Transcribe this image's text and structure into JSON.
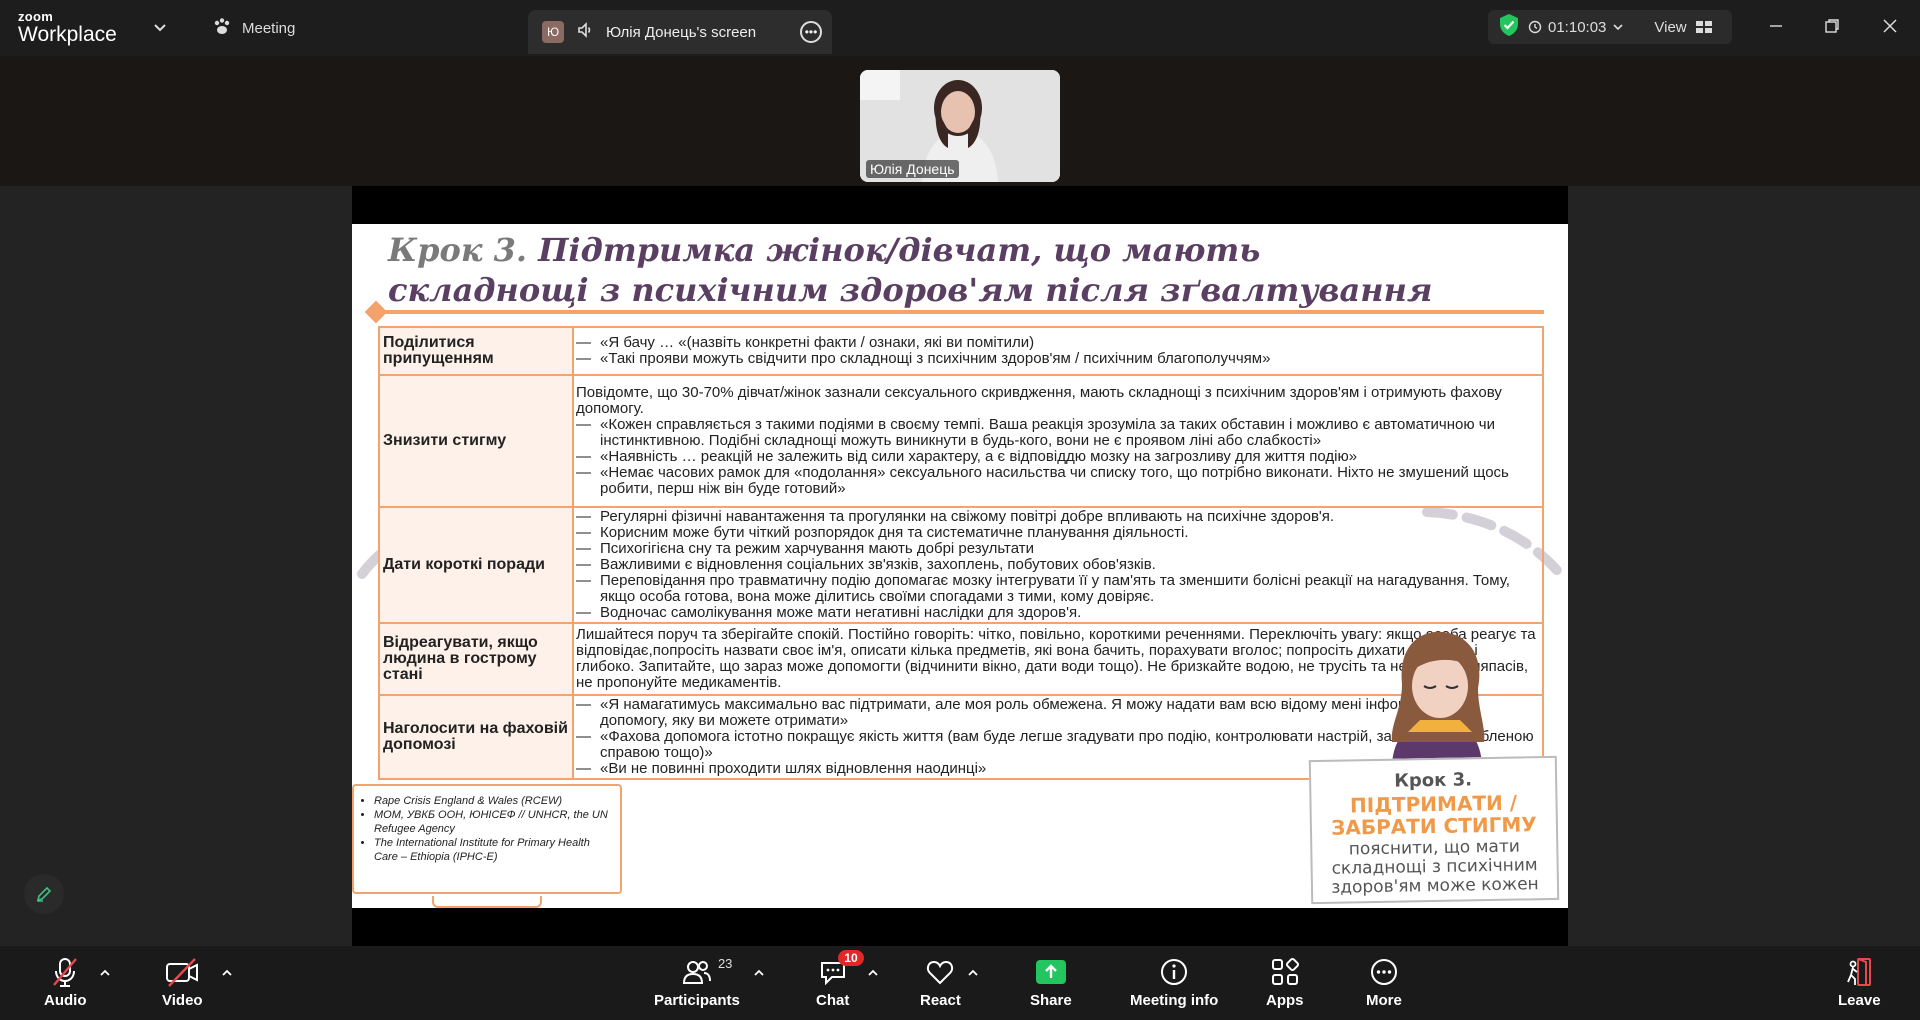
{
  "app": {
    "logo_line1": "zoom",
    "logo_line2": "Workplace"
  },
  "titlebar": {
    "meeting_label": "Meeting",
    "share_badge": "Ю",
    "share_label": "Юлія Донець's screen",
    "timer": "01:10:03",
    "view_label": "View"
  },
  "participant": {
    "name": "Юлія Донець"
  },
  "slide": {
    "title_num": "Крок 3.",
    "title_rest": "Підтримка жінок/дівчат, що мають",
    "title_line2": "складнощі з психічним здоров'ям після зґвалтування",
    "rows": [
      {
        "label": "Поділитися припущенням",
        "intro": "",
        "items": [
          "«Я бачу … «(назвіть конкретні факти / ознаки, які ви помітили)",
          "«Такі прояви можуть свідчити про складнощі з психічним здоров'ям / психічним благополуччям»"
        ]
      },
      {
        "label": "Знизити стигму",
        "intro": "Повідомте, що 30-70% дівчат/жінок зазнали сексуального скривдження, мають складнощі з психічним здоров'ям і отримують фахову допомогу.",
        "items": [
          "«Кожен справляється з такими подіями в своєму темпі.  Ваша реакція зрозуміла за таких обставин і можливо є автоматичною чи інстинктивною. Подібні складнощі можуть виникнути в будь-кого, вони не є проявом ліні або слабкості»",
          "«Наявність … реакцій не залежить від сили характеру, а є відповіддю мозку на загрозливу для життя подію»",
          "«Немає часових рамок для «подолання» сексуального насильства чи списку того, що потрібно виконати. Ніхто не змушений щось робити, перш ніж він буде готовий»"
        ]
      },
      {
        "label": "Дати короткі поради",
        "intro": "",
        "items": [
          "Регулярні фізичні навантаження та прогулянки на свіжому повітрі добре впливають на психічне здоров'я.",
          "Корисним може бути чіткий розпорядок дня та систематичне планування діяльності.",
          "Психогігієна сну та режим харчування мають добрі результати",
          "Важливими є відновлення соціальних зв'язків, захоплень, побутових обов'язків.",
          "Переповідання про травматичну подію допомагає мозку інтегрувати її у пам'ять та зменшити болісні реакції на нагадування. Тому, якщо особа готова, вона може ділитись своїми спогадами з тими, кому довіряє.",
          "Водночас самолікування може мати негативні наслідки для здоров'я."
        ]
      },
      {
        "label": "Відреагувати, якщо людина в гострому стані",
        "intro": "Лишайтеся поруч та зберігайте спокій. Постійно говоріть: чітко, повільно, короткими реченнями. Переключіть увагу: якщо особа реагує та відповідає,попросіть назвати своє ім'я, описати кілька предметів, які вона бачить, порахувати вголос; попросіть дихати повільно і глибоко. Запитайте, що зараз може допомогти (відчинити вікно, дати води тощо). Не бризкайте водою, не трусіть та не давайте ляпасів, не пропонуйте медикаментів.",
        "items": []
      },
      {
        "label": "Наголосити на фаховій допомозі",
        "intro": "",
        "items": [
          "«Я намагатимусь максимально вас підтримати, але моя роль обмежена. Я можу надати вам всю відому мені інформацію про допомогу, яку ви можете отримати»",
          "«Фахова допомога істотно покращує якість життя (вам буде легше згадувати про подію, контролювати настрій, займатися улюбленою справою тощо)»",
          "«Ви не повинні проходити шлях відновлення наодинці»"
        ]
      }
    ],
    "refs": [
      "Rape Crisis England & Wales (RCEW)",
      "МОМ, УВКБ ООН, ЮНІСЕФ //  UNHCR, the UN Refugee Agency",
      "The International Institute for Primary Health Care – Ethiopia (IPHC-E)"
    ],
    "card": {
      "step": "Крок 3.",
      "headline": "ПІДТРИМАТИ / ЗАБРАТИ СТИГМУ",
      "text": "пояснити, що мати складнощі з психічним здоров'ям може кожен"
    }
  },
  "toolbar": {
    "audio": "Audio",
    "video": "Video",
    "participants": "Participants",
    "participants_count": "23",
    "chat": "Chat",
    "chat_badge": "10",
    "react": "React",
    "share": "Share",
    "meeting_info": "Meeting info",
    "apps": "Apps",
    "more": "More",
    "leave": "Leave"
  },
  "colors": {
    "accent_orange": "#f2a36e",
    "share_green": "#22c55e",
    "badge_red": "#e02828",
    "leave_red": "#e5484d"
  }
}
